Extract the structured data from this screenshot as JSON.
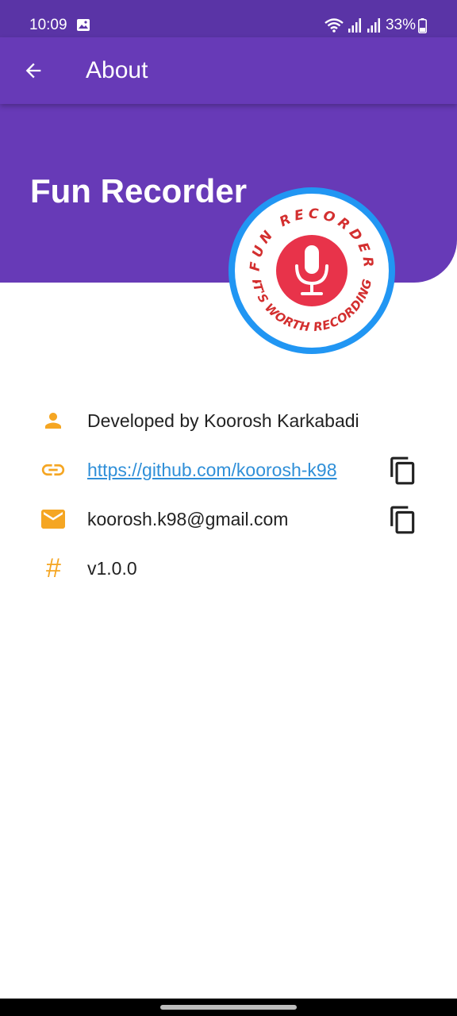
{
  "status_bar": {
    "time": "10:09",
    "battery": "33%",
    "icons": [
      "image-icon",
      "wifi-icon",
      "signal-icon",
      "signal-icon",
      "battery-icon"
    ]
  },
  "app_bar": {
    "title": "About",
    "back_icon": "arrow-back-icon"
  },
  "header": {
    "app_name": "Fun Recorder"
  },
  "logo": {
    "top_text": "FUN RECORDER",
    "bottom_text": "IT'S WORTH RECORDING",
    "ring_color": "#2196f3",
    "inner_color": "#e8334a",
    "text_color": "#d32f2f"
  },
  "info": {
    "developer": "Developed by Koorosh Karkabadi",
    "github": "https://github.com/koorosh-k98",
    "email": "koorosh.k98@gmail.com",
    "version": "v1.0.0",
    "hash_glyph": "#"
  },
  "colors": {
    "primary": "#673ab7",
    "status_bar": "#5a34a6",
    "icon_accent": "#f5a623",
    "link": "#2f8fd8"
  }
}
